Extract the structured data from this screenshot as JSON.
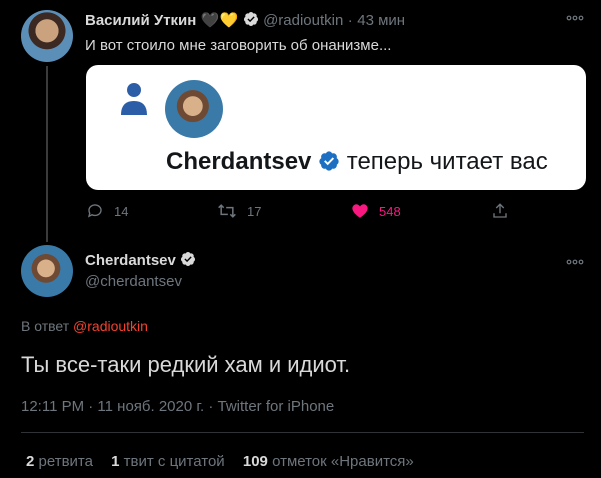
{
  "tweet1": {
    "author_name": "Василий Уткин",
    "hearts": "🖤💛",
    "handle": "@radioutkin",
    "dot": "·",
    "time": "43 мин",
    "text": "И вот стоило мне заговорить об онанизме...",
    "card": {
      "name": "Cherdantsev",
      "suffix": "теперь читает вас"
    },
    "actions": {
      "replies": "14",
      "retweets": "17",
      "likes": "548"
    },
    "colors": {
      "like": "#f91880"
    }
  },
  "tweet2": {
    "author_name": "Cherdantsev",
    "handle": "@cherdantsev",
    "reply_prefix": "В ответ",
    "reply_to": "@radioutkin",
    "text": "Ты все-таки редкий хам и идиот.",
    "meta": "12:11 PM · 11 нояб. 2020 г. · Twitter for iPhone",
    "stats": {
      "retweets_num": "2",
      "retweets_lbl": "ретвита",
      "quotes_num": "1",
      "quotes_lbl": "твит с цитатой",
      "likes_num": "109",
      "likes_lbl": "отметок «Нравится»"
    }
  },
  "more_icon": "more-icon",
  "colors": {
    "accent": "#1d9bf0",
    "reply_link": "#f4412e",
    "verified": "#1d9bf0"
  }
}
